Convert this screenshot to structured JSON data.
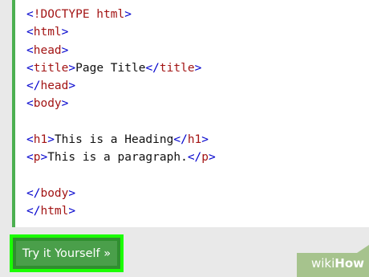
{
  "code": {
    "lines": [
      {
        "parts": [
          {
            "t": "<",
            "c": "bracket"
          },
          {
            "t": "!DOCTYPE html",
            "c": "tag"
          },
          {
            "t": ">",
            "c": "bracket"
          }
        ]
      },
      {
        "parts": [
          {
            "t": "<",
            "c": "bracket"
          },
          {
            "t": "html",
            "c": "tag"
          },
          {
            "t": ">",
            "c": "bracket"
          }
        ]
      },
      {
        "parts": [
          {
            "t": "<",
            "c": "bracket"
          },
          {
            "t": "head",
            "c": "tag"
          },
          {
            "t": ">",
            "c": "bracket"
          }
        ]
      },
      {
        "parts": [
          {
            "t": "<",
            "c": "bracket"
          },
          {
            "t": "title",
            "c": "tag"
          },
          {
            "t": ">",
            "c": "bracket"
          },
          {
            "t": "Page Title",
            "c": "text"
          },
          {
            "t": "</",
            "c": "bracket"
          },
          {
            "t": "title",
            "c": "tag"
          },
          {
            "t": ">",
            "c": "bracket"
          }
        ]
      },
      {
        "parts": [
          {
            "t": "</",
            "c": "bracket"
          },
          {
            "t": "head",
            "c": "tag"
          },
          {
            "t": ">",
            "c": "bracket"
          }
        ]
      },
      {
        "parts": [
          {
            "t": "<",
            "c": "bracket"
          },
          {
            "t": "body",
            "c": "tag"
          },
          {
            "t": ">",
            "c": "bracket"
          }
        ]
      },
      {
        "parts": []
      },
      {
        "parts": [
          {
            "t": "<",
            "c": "bracket"
          },
          {
            "t": "h1",
            "c": "tag"
          },
          {
            "t": ">",
            "c": "bracket"
          },
          {
            "t": "This is a Heading",
            "c": "text"
          },
          {
            "t": "</",
            "c": "bracket"
          },
          {
            "t": "h1",
            "c": "tag"
          },
          {
            "t": ">",
            "c": "bracket"
          }
        ]
      },
      {
        "parts": [
          {
            "t": "<",
            "c": "bracket"
          },
          {
            "t": "p",
            "c": "tag"
          },
          {
            "t": ">",
            "c": "bracket"
          },
          {
            "t": "This is a paragraph.",
            "c": "text"
          },
          {
            "t": "</",
            "c": "bracket"
          },
          {
            "t": "p",
            "c": "tag"
          },
          {
            "t": ">",
            "c": "bracket"
          }
        ]
      },
      {
        "parts": []
      },
      {
        "parts": [
          {
            "t": "</",
            "c": "bracket"
          },
          {
            "t": "body",
            "c": "tag"
          },
          {
            "t": ">",
            "c": "bracket"
          }
        ]
      },
      {
        "parts": [
          {
            "t": "</",
            "c": "bracket"
          },
          {
            "t": "html",
            "c": "tag"
          },
          {
            "t": ">",
            "c": "bracket"
          }
        ]
      }
    ]
  },
  "button": {
    "label": "Try it Yourself »"
  },
  "watermark": {
    "wiki": "wiki",
    "how": "How"
  },
  "colors": {
    "accent_border": "#4caf50",
    "button_bg": "#4a9f4a",
    "button_highlight": "#1aff00",
    "tag": "#a31515",
    "bracket": "#0000cd"
  }
}
